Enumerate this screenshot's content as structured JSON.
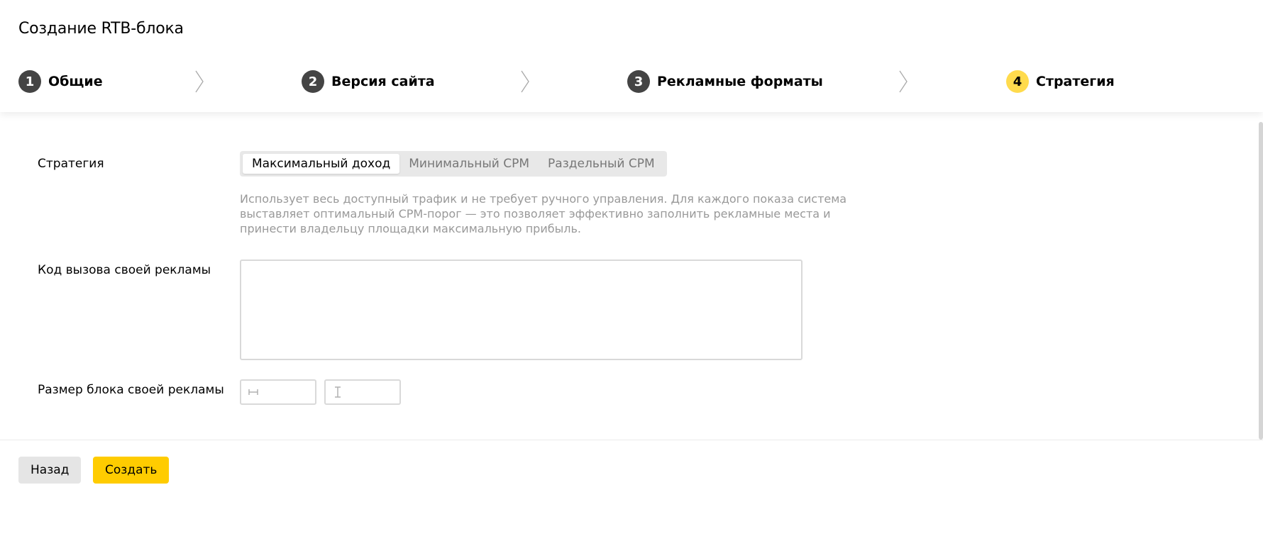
{
  "header": {
    "title": "Создание RTB-блока",
    "steps": [
      {
        "number": "1",
        "label": "Общие",
        "active": false
      },
      {
        "number": "2",
        "label": "Версия сайта",
        "active": false
      },
      {
        "number": "3",
        "label": "Рекламные форматы",
        "active": false
      },
      {
        "number": "4",
        "label": "Стратегия",
        "active": true
      }
    ]
  },
  "form": {
    "strategy": {
      "label": "Стратегия",
      "options": [
        "Максимальный доход",
        "Минимальный CPM",
        "Раздельный CPM"
      ],
      "selected": "Максимальный доход",
      "description": "Использует весь доступный трафик и не требует ручного управления. Для каждого показа система выставляет оптимальный CPM-порог — это позволяет эффективно заполнить рекламные места и принести владельцу площадки максимальную прибыль."
    },
    "ad_code": {
      "label": "Код вызова своей рекламы",
      "value": ""
    },
    "ad_size": {
      "label": "Размер блока своей рекламы",
      "width_value": "",
      "height_value": ""
    }
  },
  "footer": {
    "back_label": "Назад",
    "create_label": "Создать"
  },
  "colors": {
    "accent_yellow": "#ffcc00",
    "active_step": "#ffdb4d",
    "step_inactive": "#444444",
    "popup_blue": "#0a63e0"
  },
  "icons": {
    "width_icon": "width-arrows-icon",
    "height_icon": "height-cursor-icon",
    "chevron": "chevron-right-icon"
  }
}
